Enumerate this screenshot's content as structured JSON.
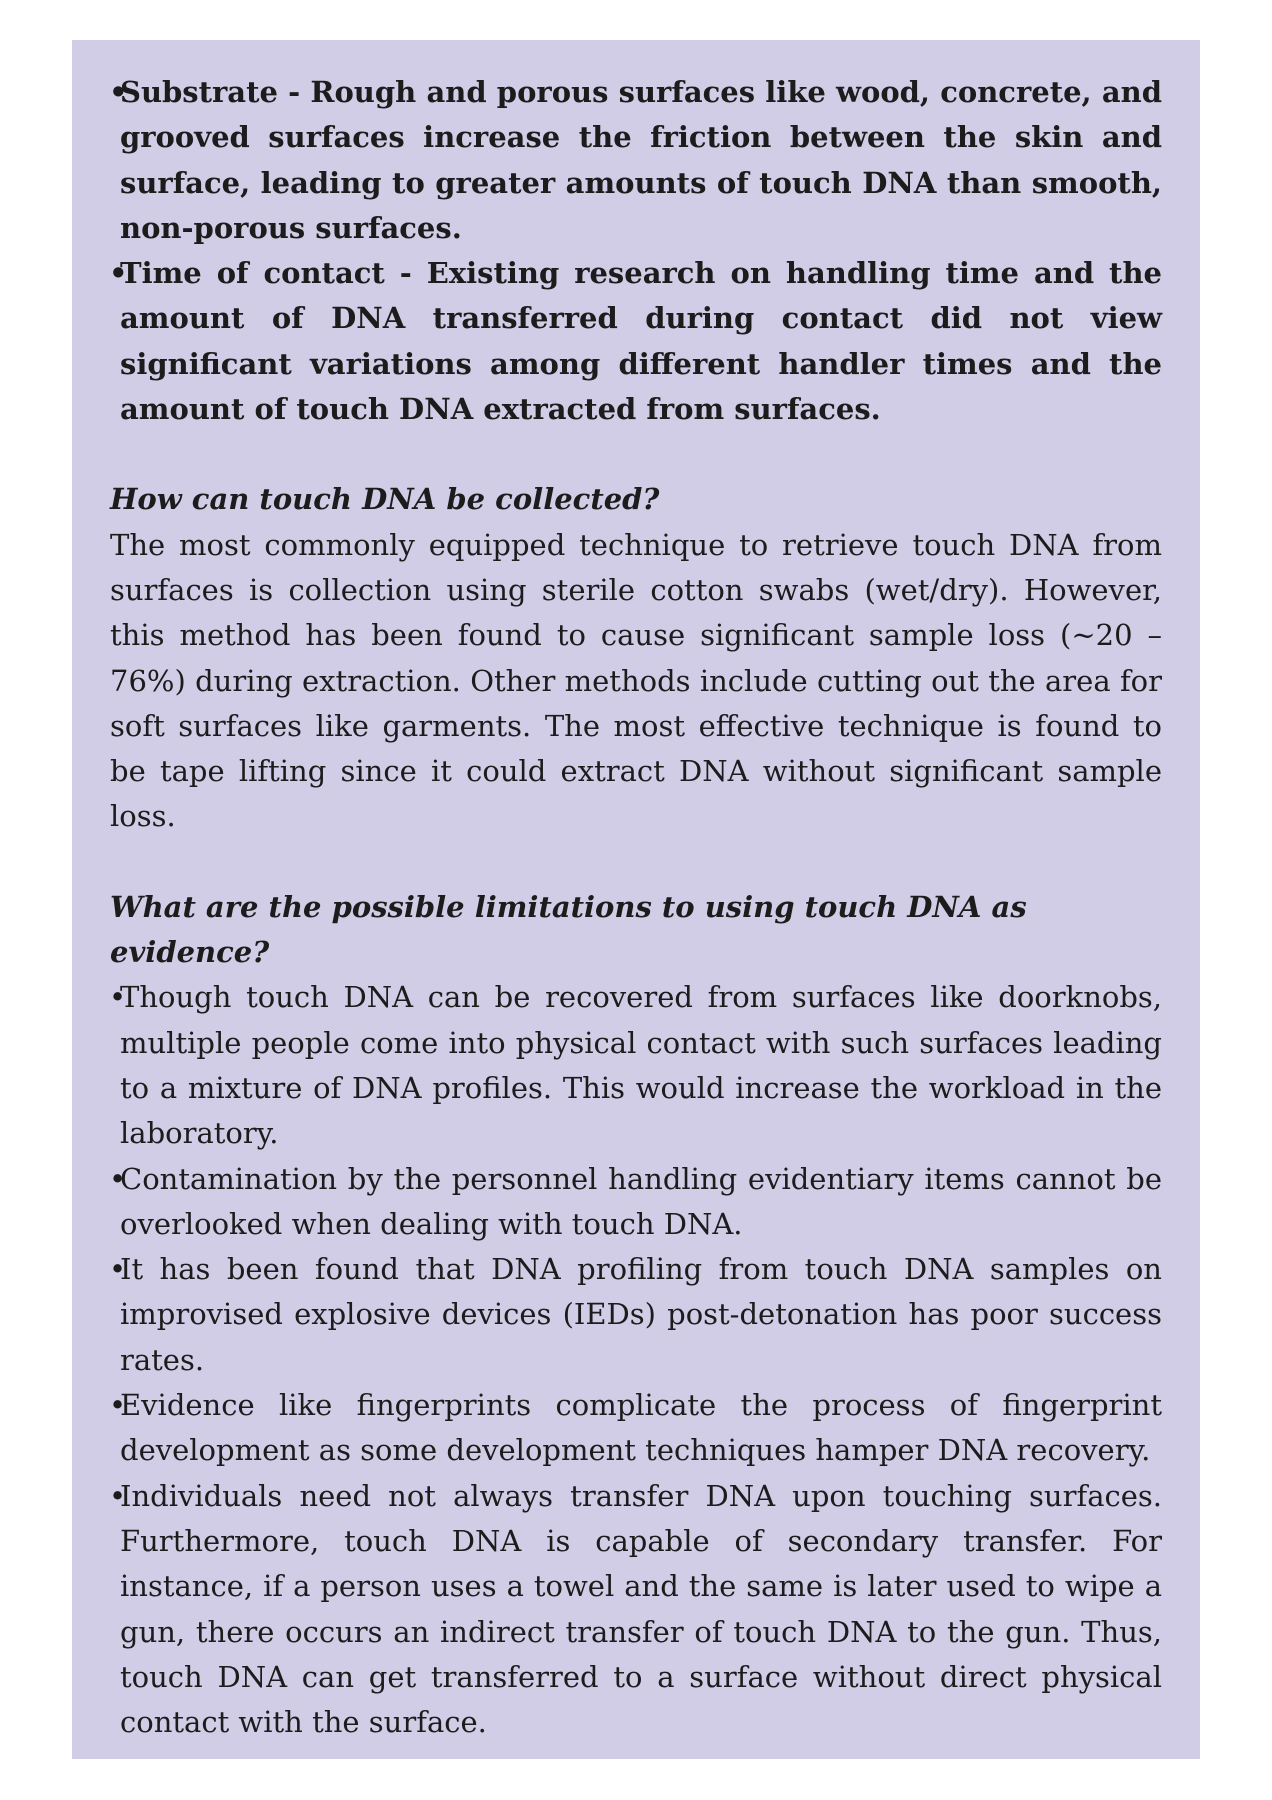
{
  "bold_bullets": [
    "Substrate - Rough and porous surfaces like wood, concrete, and grooved surfaces increase the friction between the skin and surface, leading to greater amounts of touch DNA than smooth, non-porous surfaces.",
    "Time of contact - Existing research on handling time and the amount of DNA transferred during contact did not view significant variations among different handler times and the amount of touch DNA extracted from surfaces."
  ],
  "section1": {
    "heading": "How can touch DNA be collected?",
    "paragraph": "The most commonly equipped technique to retrieve touch DNA from surfaces is collection using sterile cotton swabs (wet/dry). However, this method has been found to cause significant sample loss (~20 –76%) during extraction. Other methods include cutting out the area for soft surfaces like garments. The most effective technique is found to be tape lifting since it could extract DNA without significant sample loss."
  },
  "section2": {
    "heading": "What are the possible limitations to using touch DNA as evidence?",
    "bullets": [
      "Though touch DNA can be recovered from surfaces like doorknobs, multiple people come into physical contact with such surfaces leading to a mixture of DNA profiles. This would increase the workload in the laboratory.",
      "Contamination by the personnel handling evidentiary items cannot be overlooked when dealing with touch DNA.",
      "It has been found that DNA profiling from touch DNA samples on improvised explosive devices (IEDs) post-detonation has poor success rates.",
      "Evidence like fingerprints complicate the process of fingerprint development as some development techniques hamper DNA recovery.",
      "Individuals need not always transfer DNA upon touching surfaces. Furthermore, touch DNA is capable of secondary transfer. For instance, if a person uses a towel and the same is later used to wipe a gun, there occurs an indirect transfer of touch DNA to the gun. Thus, touch DNA can get transferred to a surface without direct physical contact with the surface."
    ]
  }
}
